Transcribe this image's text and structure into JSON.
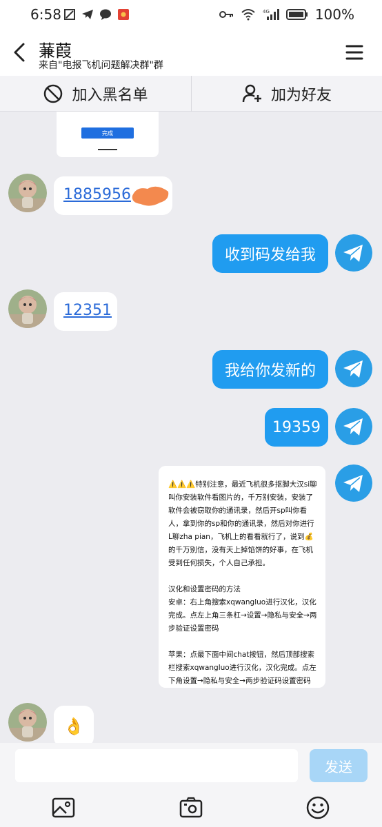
{
  "status_bar": {
    "time": "6:58",
    "battery": "100%",
    "network": "4G"
  },
  "header": {
    "title": "蒹葭",
    "subtitle": "来自\"电报飞机问题解决群\"群"
  },
  "actions": {
    "block": "加入黑名单",
    "add_friend": "加为好友"
  },
  "chat": {
    "image_card_button": "完成",
    "messages": [
      {
        "side": "in",
        "type": "link",
        "text": "1885956"
      },
      {
        "side": "out",
        "type": "text",
        "text": "收到码发给我"
      },
      {
        "side": "in",
        "type": "link",
        "text": "12351"
      },
      {
        "side": "out",
        "type": "text",
        "text": "我给你发新的"
      },
      {
        "side": "out",
        "type": "text",
        "text": "19359"
      },
      {
        "side": "in",
        "type": "emoji",
        "text": "👌"
      }
    ],
    "notice": {
      "paragraph1": "⚠️⚠️⚠️特别注意，最近飞机很多抠脚大汉si聊叫你安装软件看图片的，千万别安装，安装了软件会被窃取你的通讯录，然后开sp叫你看人，拿到你的sp和你的通讯录，然后对你进行L聊zha pian，飞机上的看看就行了，说到💰的千万别信，没有天上掉馅饼的好事，在飞机受到任何损失，个人自己承担。",
      "paragraph2_title": "汉化和设置密码的方法",
      "paragraph2": "安卓：右上角搜索xqwangluo进行汉化，汉化完成。点左上角三条杠→设置→隐私与安全→两步验证设置密码",
      "paragraph3": "苹果：点最下面中间chat按钮，然后顶部搜索栏搜索xqwangluo进行汉化，汉化完成。点左下角设置→隐私与安全→两步验证码设置密码"
    }
  },
  "input": {
    "value": "",
    "placeholder": "",
    "send_label": "发送"
  },
  "colors": {
    "accent": "#209cf0",
    "send_disabled": "#a8d6f7",
    "link": "#2a6ad8",
    "background": "#ececf0"
  },
  "icons": {
    "back": "chevron-left-icon",
    "menu": "hamburger-menu-icon",
    "block": "block-icon",
    "add_friend": "add-user-icon",
    "image": "image-icon",
    "camera": "camera-icon",
    "emoji": "emoji-icon",
    "telegram": "telegram-icon"
  }
}
